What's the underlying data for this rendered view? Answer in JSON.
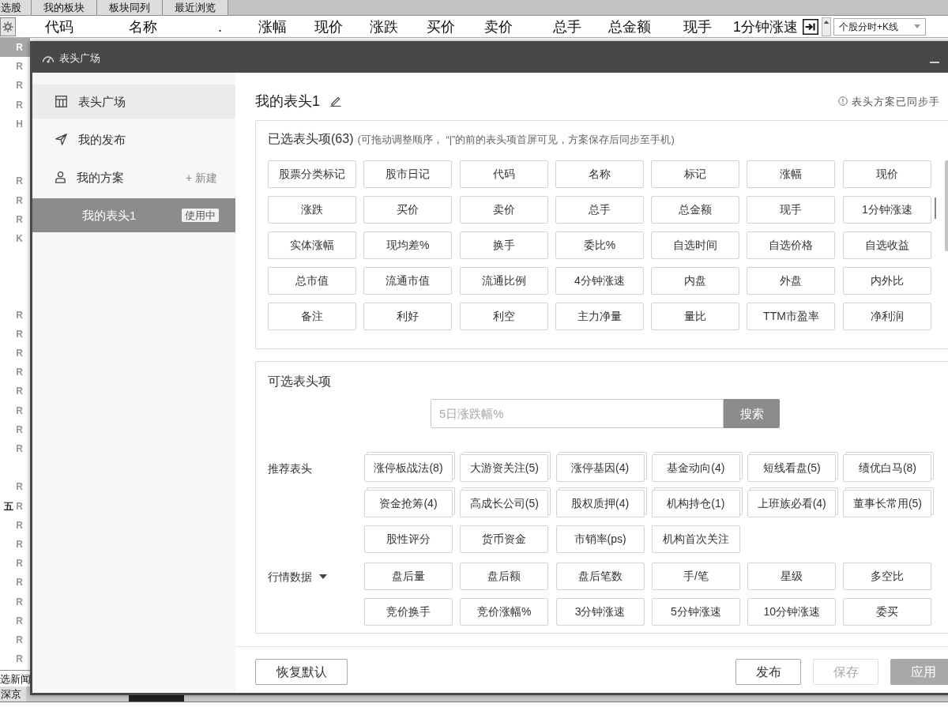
{
  "app": {
    "top_tabs": [
      {
        "label": "选股",
        "selected": false
      },
      {
        "label": "我的板块",
        "selected": false
      },
      {
        "label": "板块同列",
        "selected": false
      },
      {
        "label": "最近浏览",
        "selected": false
      }
    ],
    "columns": [
      "代码",
      "名称",
      ".",
      "涨幅",
      "现价",
      "涨跌",
      "买价",
      "卖价",
      "总手",
      "总金额",
      "现手",
      "1分钟涨速"
    ],
    "view_dropdown": "个股分时+K线",
    "row_markers": [
      {
        "kind": "marker",
        "text": "R",
        "selected": true
      },
      {
        "kind": "marker",
        "text": "R",
        "selected": false
      },
      {
        "kind": "marker",
        "text": "R",
        "selected": false
      },
      {
        "kind": "marker",
        "text": "R",
        "selected": false
      },
      {
        "kind": "marker",
        "text": "H",
        "selected": false
      },
      {
        "kind": "blank",
        "selected": false
      },
      {
        "kind": "blank",
        "selected": false
      },
      {
        "kind": "marker",
        "text": "R",
        "selected": false
      },
      {
        "kind": "marker",
        "text": "R",
        "selected": false
      },
      {
        "kind": "marker",
        "text": "R",
        "selected": false
      },
      {
        "kind": "marker",
        "text": "K",
        "selected": false
      },
      {
        "kind": "blank",
        "selected": false
      },
      {
        "kind": "blank",
        "selected": false
      },
      {
        "kind": "blank",
        "selected": false
      },
      {
        "kind": "marker",
        "text": "R",
        "selected": false
      },
      {
        "kind": "marker",
        "text": "R",
        "selected": false
      },
      {
        "kind": "marker",
        "text": "R",
        "selected": false
      },
      {
        "kind": "marker",
        "text": "R",
        "selected": false
      },
      {
        "kind": "marker",
        "text": "R",
        "selected": false
      },
      {
        "kind": "marker",
        "text": "R",
        "selected": false
      },
      {
        "kind": "marker",
        "text": "R",
        "selected": false
      },
      {
        "kind": "marker",
        "text": "R",
        "selected": false
      },
      {
        "kind": "blank",
        "selected": false
      },
      {
        "kind": "marker",
        "text": "R",
        "selected": false
      },
      {
        "kind": "marker",
        "text": "R",
        "tag": "五",
        "selected": false
      },
      {
        "kind": "marker",
        "text": "R",
        "selected": false
      },
      {
        "kind": "marker",
        "text": "R",
        "selected": false
      },
      {
        "kind": "marker",
        "text": "R",
        "selected": false
      },
      {
        "kind": "marker",
        "text": "R",
        "selected": false
      },
      {
        "kind": "marker",
        "text": "R",
        "selected": false
      },
      {
        "kind": "marker",
        "text": "R",
        "selected": false
      },
      {
        "kind": "marker",
        "text": "R",
        "selected": false
      },
      {
        "kind": "marker",
        "text": "R",
        "selected": false
      }
    ],
    "news_tab": "选新闻",
    "bottom_tabs": [
      {
        "label": "深京",
        "selected": false
      }
    ]
  },
  "dialog": {
    "title": "表头广场",
    "sidebar": [
      {
        "label": "表头广场",
        "selected": false,
        "hovered": true
      },
      {
        "label": "我的发布",
        "selected": false,
        "hovered": false
      },
      {
        "label": "我的方案",
        "selected": false,
        "hovered": false,
        "action": "+ 新建",
        "children": [
          {
            "label": "我的表头1",
            "selected": true,
            "badge": "使用中"
          }
        ]
      }
    ],
    "scheme_title": "我的表头1",
    "sync_notice": "表头方案已同步手",
    "selected_columns": {
      "title": "已选表头项(63)",
      "hint": "(可拖动调整顺序， “|”的前的表头项首屏可见，方案保存后同步至手机)",
      "items": [
        {
          "label": "股票分类标记",
          "divider_after": false
        },
        {
          "label": "股市日记",
          "divider_after": false
        },
        {
          "label": "代码",
          "divider_after": false
        },
        {
          "label": "名称",
          "divider_after": false
        },
        {
          "label": "标记",
          "divider_after": false
        },
        {
          "label": "涨幅",
          "divider_after": false
        },
        {
          "label": "现价",
          "divider_after": false
        },
        {
          "label": "涨跌",
          "divider_after": false
        },
        {
          "label": "买价",
          "divider_after": false
        },
        {
          "label": "卖价",
          "divider_after": false
        },
        {
          "label": "总手",
          "divider_after": false
        },
        {
          "label": "总金额",
          "divider_after": false
        },
        {
          "label": "现手",
          "divider_after": false
        },
        {
          "label": "1分钟涨速",
          "divider_after": true
        },
        {
          "label": "实体涨幅",
          "divider_after": false
        },
        {
          "label": "现均差%",
          "divider_after": false
        },
        {
          "label": "换手",
          "divider_after": false
        },
        {
          "label": "委比%",
          "divider_after": false
        },
        {
          "label": "自选时间",
          "divider_after": false
        },
        {
          "label": "自选价格",
          "divider_after": false
        },
        {
          "label": "自选收益",
          "divider_after": false
        },
        {
          "label": "总市值",
          "divider_after": false
        },
        {
          "label": "流通市值",
          "divider_after": false
        },
        {
          "label": "流通比例",
          "divider_after": false
        },
        {
          "label": "4分钟涨速",
          "divider_after": false
        },
        {
          "label": "内盘",
          "divider_after": false
        },
        {
          "label": "外盘",
          "divider_after": false
        },
        {
          "label": "内外比",
          "divider_after": false
        },
        {
          "label": "备注",
          "divider_after": false
        },
        {
          "label": "利好",
          "divider_after": false
        },
        {
          "label": "利空",
          "divider_after": false
        },
        {
          "label": "主力净量",
          "divider_after": false
        },
        {
          "label": "量比",
          "divider_after": false
        },
        {
          "label": "TTM市盈率",
          "divider_after": false
        },
        {
          "label": "净利润",
          "divider_after": false
        }
      ]
    },
    "available_columns": {
      "title": "可选表头项",
      "search": {
        "placeholder": "5日涨跌幅%",
        "button": "搜索"
      },
      "groups": [
        {
          "label": "推荐表头",
          "items": [
            {
              "label": "涨停板战法(8)",
              "kind": "bundle"
            },
            {
              "label": "大游资关注(5)",
              "kind": "bundle"
            },
            {
              "label": "涨停基因(4)",
              "kind": "bundle"
            },
            {
              "label": "基金动向(4)",
              "kind": "bundle"
            },
            {
              "label": "短线看盘(5)",
              "kind": "bundle"
            },
            {
              "label": "绩优白马(8)",
              "kind": "bundle"
            },
            {
              "label": "资金抢筹(4)",
              "kind": "bundle"
            },
            {
              "label": "高成长公司(5)",
              "kind": "bundle"
            },
            {
              "label": "股权质押(4)",
              "kind": "bundle"
            },
            {
              "label": "机构持仓(1)",
              "kind": "bundle"
            },
            {
              "label": "上班族必看(4)",
              "kind": "bundle"
            },
            {
              "label": "董事长常用(5)",
              "kind": "bundle"
            },
            {
              "label": "股性评分",
              "kind": "field"
            },
            {
              "label": "货币资金",
              "kind": "field"
            },
            {
              "label": "市销率(ps)",
              "kind": "field"
            },
            {
              "label": "机构首次关注",
              "kind": "field"
            }
          ]
        },
        {
          "label": "行情数据",
          "expanded": true,
          "items": [
            {
              "label": "盘后量",
              "kind": "field"
            },
            {
              "label": "盘后额",
              "kind": "field"
            },
            {
              "label": "盘后笔数",
              "kind": "field"
            },
            {
              "label": "手/笔",
              "kind": "field"
            },
            {
              "label": "星级",
              "kind": "field"
            },
            {
              "label": "多空比",
              "kind": "field"
            },
            {
              "label": "竞价换手",
              "kind": "field"
            },
            {
              "label": "竞价涨幅%",
              "kind": "field"
            },
            {
              "label": "3分钟涨速",
              "kind": "field"
            },
            {
              "label": "5分钟涨速",
              "kind": "field"
            },
            {
              "label": "10分钟涨速",
              "kind": "field"
            },
            {
              "label": "委买",
              "kind": "field"
            }
          ]
        }
      ]
    },
    "buttons": [
      {
        "label": "恢复默认",
        "kind": "reset",
        "disabled": false
      },
      {
        "label": "发布",
        "kind": "outline",
        "disabled": false
      },
      {
        "label": "保存",
        "kind": "outline",
        "disabled": true
      },
      {
        "label": "应用",
        "kind": "primary",
        "disabled": true
      }
    ]
  }
}
